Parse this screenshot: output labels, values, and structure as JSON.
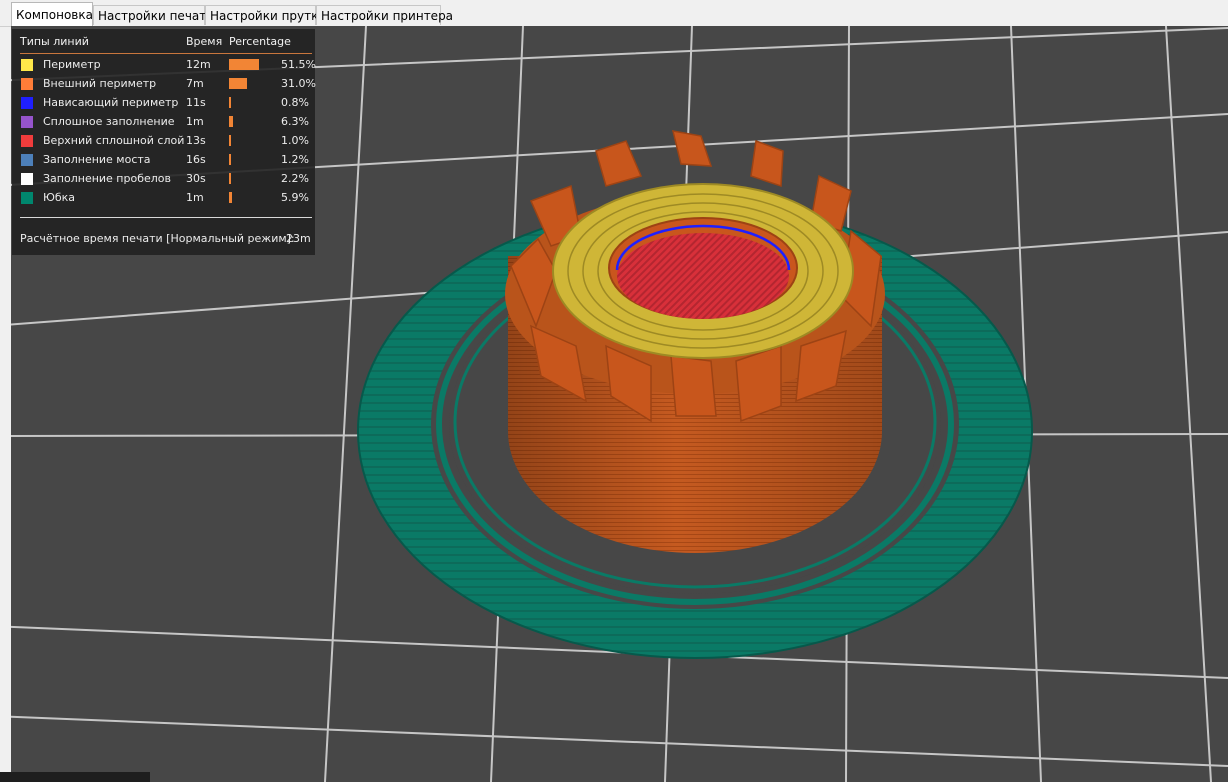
{
  "tabs": [
    {
      "label": "Компоновка",
      "active": true
    },
    {
      "label": "Настройки печати",
      "active": false
    },
    {
      "label": "Настройки прутка",
      "active": false
    },
    {
      "label": "Настройки принтера",
      "active": false
    }
  ],
  "legend": {
    "headers": {
      "type": "Типы линий",
      "time": "Время",
      "percentage": "Percentage"
    },
    "rows": [
      {
        "label": "Периметр",
        "time": "12m",
        "percent": "51.5%",
        "pct": 51.5,
        "color": "#ffe84a"
      },
      {
        "label": "Внешний периметр",
        "time": "7m",
        "percent": "31.0%",
        "pct": 31.0,
        "color": "#ff7d38"
      },
      {
        "label": "Нависающий периметр",
        "time": "11s",
        "percent": "0.8%",
        "pct": 0.8,
        "color": "#1f1fff"
      },
      {
        "label": "Сплошное заполнение",
        "time": "1m",
        "percent": "6.3%",
        "pct": 6.3,
        "color": "#9654cc"
      },
      {
        "label": "Верхний сплошной слой",
        "time": "13s",
        "percent": "1.0%",
        "pct": 1.0,
        "color": "#f03c3c"
      },
      {
        "label": "Заполнение моста",
        "time": "16s",
        "percent": "1.2%",
        "pct": 1.2,
        "color": "#4d80ba"
      },
      {
        "label": "Заполнение пробелов",
        "time": "30s",
        "percent": "2.2%",
        "pct": 2.2,
        "color": "#ffffff"
      },
      {
        "label": "Юбка",
        "time": "1m",
        "percent": "5.9%",
        "pct": 5.9,
        "color": "#00876e"
      }
    ],
    "estimate_label": "Расчётное время печати [Нормальный режим]:",
    "estimate_value": "23m"
  },
  "colors": {
    "bed": "#474747",
    "grid": "#d4d4d4",
    "skirt": "#0a7a66",
    "outer_wall": "#c8561c",
    "perimeter": "#d8be3c",
    "top_solid": "#d2303a",
    "overhang": "#1f1fff"
  }
}
